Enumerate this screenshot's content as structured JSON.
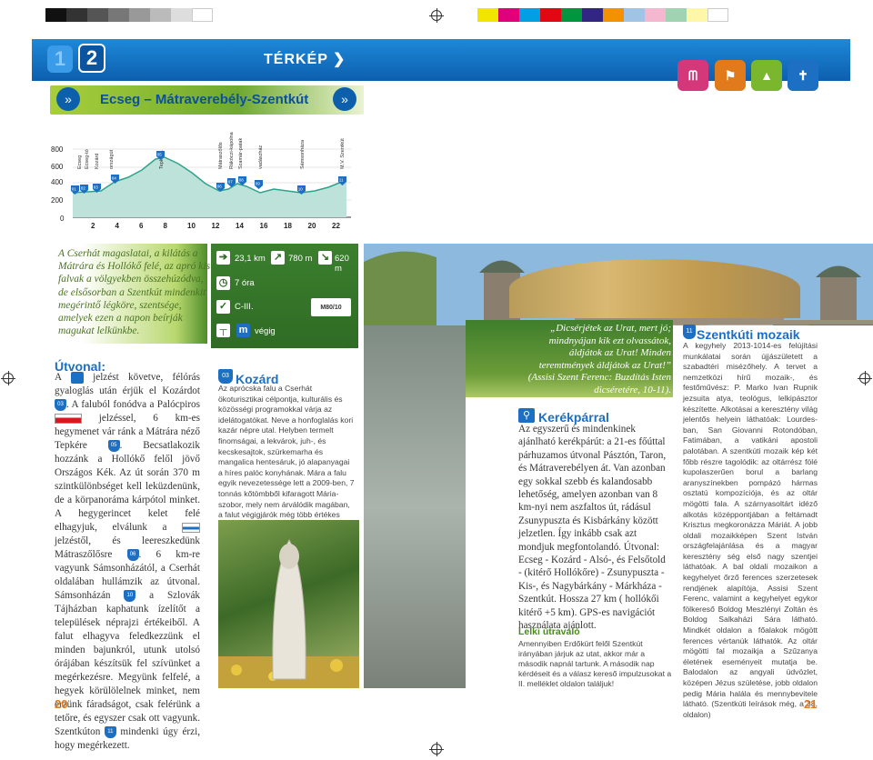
{
  "header": {
    "page_left_num": "1",
    "page_right_num": "2",
    "section": "TÉRKÉP ❯",
    "colors": {
      "accent": "#1d6fc3",
      "green": "#3b7f2e",
      "orange": "#e07a1b"
    },
    "icons": [
      {
        "name": "ml-icon",
        "bg": "#d4377a",
        "glyph": "ᗰ"
      },
      {
        "name": "hiker-group-icon",
        "bg": "#e07a1b",
        "glyph": "⚑"
      },
      {
        "name": "tree-icon",
        "bg": "#7ab72f",
        "glyph": "▲"
      },
      {
        "name": "church-icon",
        "bg": "#1d6fc3",
        "glyph": "✝"
      }
    ]
  },
  "route": {
    "title": "Ecseg – Mátraverebély-Szentkút"
  },
  "profile": {
    "y_ticks": [
      "800",
      "600",
      "400",
      "200",
      "0"
    ],
    "x_ticks": [
      "2",
      "4",
      "6",
      "8",
      "10",
      "12",
      "14",
      "16",
      "18",
      "20",
      "22"
    ],
    "places": [
      "Ecseg",
      "Ecseg-tó",
      "Kozárd",
      "országút",
      "Tepke-h.",
      "Mátraszőlős",
      "Rákóczi-kápolna",
      "Szamár-patak",
      "vadászház",
      "Sámsonháza",
      "M.V. Szentkút"
    ],
    "markers": [
      "01",
      "02",
      "03",
      "04",
      "05",
      "06",
      "07",
      "08",
      "09",
      "10",
      "11"
    ]
  },
  "intro": "A Cserhát magaslatai, a kilátás a Mátrára és Hollókő felé, az apró kis falvak a völgyekben összehúzódva, de elsősorban a Szentkút mindenkit megérintő légköre, szentsége, amelyek ezen a napon beírják magukat lelkünkbe.",
  "stats": {
    "distance": "23,1 km",
    "ascent": "780 m",
    "descent": "620 m",
    "time": "7 óra",
    "difficulty": "C-III.",
    "map": "M80/10",
    "mark_text": "végig"
  },
  "utvonal": {
    "heading": "Útvonal:",
    "p1": "jelzést követve, félórás gyaloglás után érjük el Kozárdot",
    "p2": ". A faluból fonódva a Palócpiros",
    "p3": "jelzéssel, 6 km-es hegymenet vár ránk a Mátrára néző Tepkére",
    "p4": ". Becsatlakozik hozzánk a Hollókő felől jövő Országos Kék. Az út során 370 m szintkülönbséget kell leküzdenünk, de a körpanoráma kárpótol minket. A hegygerincet kelet felé elhagyjuk, elválunk a",
    "p5": "jelzéstől, és leereszkedünk Mátraszőlősre",
    "p6": ". 6 km-re vagyunk Sámsonházától, a Cserhát oldalában hullámzik az útvonal. Sámsonházán",
    "p7": "a Szlovák Tájházban kaphatunk ízelítőt a települések néprajzi értékeiből. A falut elhagyva feledkezzünk el minden bajunkról, utunk utolsó órájában készítsük fel szívünket a megérkezésre. Megyünk felfelé, a hegyek körülölelnek minket, nem érzünk fáradságot, csak felérünk a tetőre, és egyszer csak ott vagyunk. Szentkúton",
    "p8": "mindenki úgy érzi, hogy megérkezett.",
    "lead": "A"
  },
  "kozard": {
    "heading": "Kozárd",
    "num": "03",
    "text": "Az aprócska falu a Cserhát ökoturisztikai célpontja, kulturális és közösségi programokkal várja az idelátogatókat. Neve a honfoglalás kori kazár népre utal. Helyben termelt finomságai, a lekvárok, juh-, és kecskesajtok, szürkemarha és mangalica hentesáruk, jó alapanyagai a híres palóc konyhának. Mára a falu egyik nevezetessége lett a 2009-ben, 7 tonnás kőtömbből kifaragott Mária-szobor, mely nem árválódik magában, a falut végigjárók még több értékes alkotást fognak felfedezni."
  },
  "quote": {
    "text": "„Dicsérjétek az Urat, mert jó; mindnyájan kik ezt olvassátok, áldjátok az Urat! Minden teremtmények áldjátok az Urat!”",
    "source": "(Assisi Szent Ferenc: Buzdítás Isten dicséretére, 10-11)."
  },
  "kerekparral": {
    "heading": "Kerékpárral",
    "text": "Az egyszerű és mindenkinek ajánlható kerékpárút: a 21-es főúttal párhuzamos útvonal Pásztón, Taron, és Mátraverebélyen át. Van azonban egy sokkal szebb és kalandosabb lehetőség, amelyen azonban van 8 km-nyi nem aszfaltos út, rádásul Zsunypuszta és Kisbárkány között jelzetlen. Így inkább csak azt mondjuk megfontolandó. Útvonal: Ecseg - Kozárd - Alsó-, és Felsőtold - (kitérő Hollókőre) - Zsunypuszta - Kis-, és Nagybárkány - Márkháza - Szentkút. Hossza 27 km ( hollókői kitérő +5 km). GPS-es navigációt használata ajánlott."
  },
  "lelki": {
    "heading": "Lelki útravaló",
    "text": "Amennyiben Erdőkürt felől Szentkút irányában járjuk az utat, akkor már a második napnál tartunk. A második nap kérdéseit és a válasz kereső impulzusokat a II. melléklet oldalon találjuk!"
  },
  "mozaik": {
    "heading": "Szentkúti mozaik",
    "num": "11",
    "text": "A kegyhely 2013-1014-es felújítási munkálatai során újjászületett a szabadtéri misézőhely. A tervet a nemzetközi hírű mozaik-, és festőművész: P. Marko Ivan Rupnik jezsuita atya, teológus, lelkipásztor készítette. Alkotásai a keresztény világ jelentős helyein láthatóak: Lourdes-ban, San Giovanni Rotondóban, Fatimában, a vatikáni apostoli palotában. A szentkúti mozaik kép két főbb részre tagolódik: az oltárrész fölé kupolaszerűen borul a barlang aranyszínekben pompázó hármas osztatú kompozíciója, és az oltár mögötti fala. A szárnyasoltárt idéző alkotás középpontjában a feltámadt Krisztus megkoronázza Máriát. A jobb oldali mozaikképen Szent István országfelajánlása és a magyar keresztény ség első nagy szentjei láthatóak. A bal oldali mozaikon a kegyhelyet őrző ferences szerzetesek rendjének alapítója, Assisi Szent Ferenc, valamint a kegyhelyet egykor fölkereső Boldog Meszlényi Zoltán és Boldog Salkaházi Sára látható. Mindkét oldalon a főalakok mögött ferences vértanúk láthatók. Az oltár mögötti fal mozaikja a Szűzanya életének eseményeit mutatja be. Balodalon az angyali üdvözlet, középen Jézus születése, jobb oldalon pedig Mária halála és mennybevitele látható. (Szentkúti leírások még, a 38. oldalon)"
  },
  "footer": {
    "left": "20",
    "right": "21"
  }
}
